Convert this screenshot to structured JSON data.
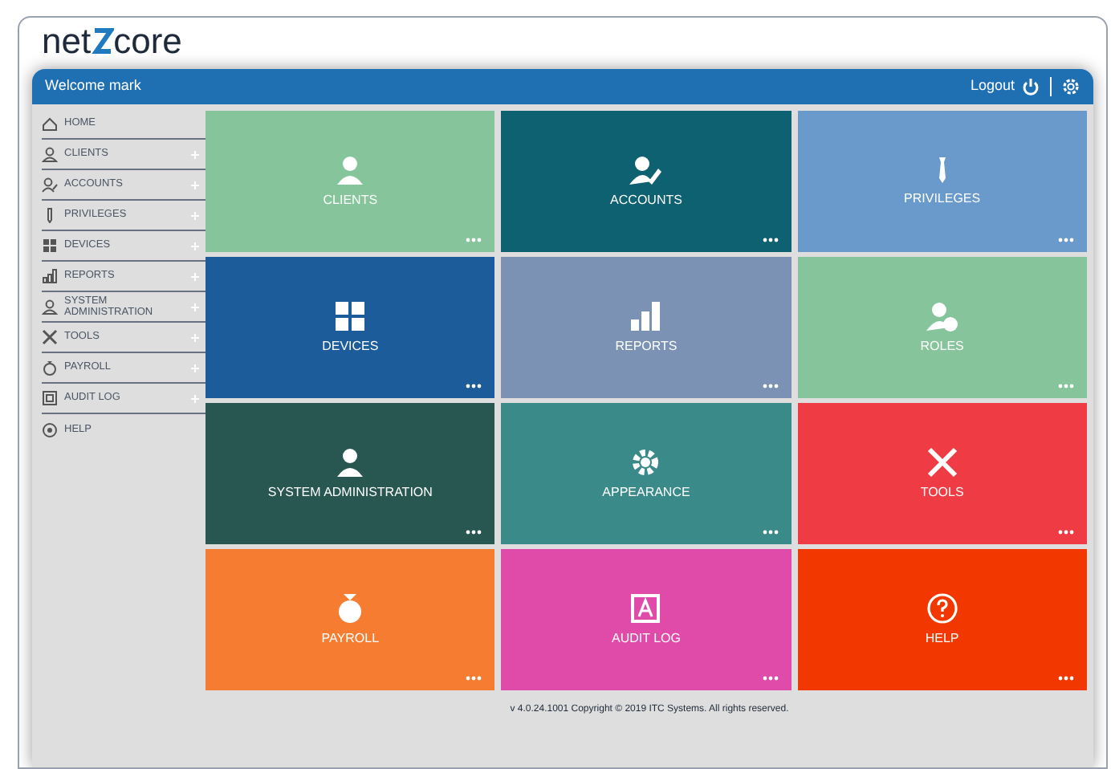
{
  "logo": {
    "left": "net",
    "right": "core"
  },
  "header": {
    "welcome": "Welcome mark",
    "logout": "Logout"
  },
  "sidebar": {
    "items": [
      {
        "label": "HOME",
        "expandable": false
      },
      {
        "label": "CLIENTS",
        "expandable": true
      },
      {
        "label": "ACCOUNTS",
        "expandable": true
      },
      {
        "label": "PRIVILEGES",
        "expandable": true
      },
      {
        "label": "DEVICES",
        "expandable": true
      },
      {
        "label": "REPORTS",
        "expandable": true
      },
      {
        "label": "SYSTEM ADMINISTRATION",
        "expandable": true
      },
      {
        "label": "TOOLS",
        "expandable": true
      },
      {
        "label": "PAYROLL",
        "expandable": true
      },
      {
        "label": "AUDIT LOG",
        "expandable": true
      },
      {
        "label": "HELP",
        "expandable": false
      }
    ]
  },
  "tiles": [
    {
      "label": "CLIENTS",
      "color": "#86c59b"
    },
    {
      "label": "ACCOUNTS",
      "color": "#0e6170"
    },
    {
      "label": "PRIVILEGES",
      "color": "#6a9acb"
    },
    {
      "label": "DEVICES",
      "color": "#1c5c9b"
    },
    {
      "label": "REPORTS",
      "color": "#7b92b5"
    },
    {
      "label": "ROLES",
      "color": "#86c59b"
    },
    {
      "label": "SYSTEM ADMINISTRATION",
      "color": "#285650"
    },
    {
      "label": "APPEARANCE",
      "color": "#3a8a8a"
    },
    {
      "label": "TOOLS",
      "color": "#ee3b44"
    },
    {
      "label": "PAYROLL",
      "color": "#f57c30"
    },
    {
      "label": "AUDIT LOG",
      "color": "#e04aa8"
    },
    {
      "label": "HELP",
      "color": "#f23800"
    }
  ],
  "footer": "v 4.0.24.1001 Copyright © 2019 ITC Systems. All rights reserved."
}
